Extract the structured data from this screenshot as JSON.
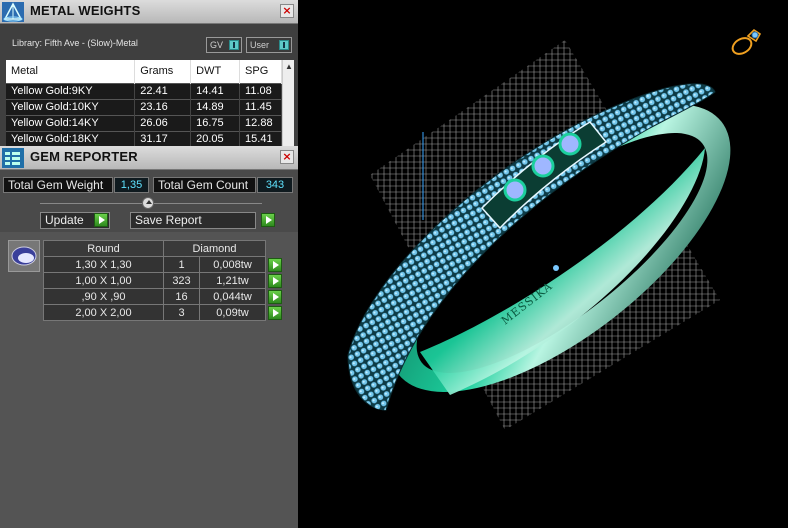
{
  "metal_weights": {
    "title": "METAL WEIGHTS",
    "close": "×",
    "library": "Library: Fifth Ave - (Slow)-Metal",
    "gv_label": "GV",
    "user_label": "User",
    "columns": [
      "Metal",
      "Grams",
      "DWT",
      "SPG"
    ],
    "rows": [
      [
        "Yellow Gold:9KY",
        "22.41",
        "14.41",
        "11.08"
      ],
      [
        "Yellow Gold:10KY",
        "23.16",
        "14.89",
        "11.45"
      ],
      [
        "Yellow Gold:14KY",
        "26.06",
        "16.75",
        "12.88"
      ],
      [
        "Yellow Gold:18KY",
        "31.17",
        "20.05",
        "15.41"
      ]
    ]
  },
  "gem_reporter": {
    "title": "GEM REPORTER",
    "close": "×",
    "total_weight_label": "Total Gem Weight",
    "total_weight_value": "1,35",
    "total_count_label": "Total Gem Count",
    "total_count_value": "343",
    "update_label": "Update",
    "save_label": "Save Report",
    "columns": [
      "Round",
      "Diamond"
    ],
    "rows": [
      [
        "1,30 X 1,30",
        "1",
        "0,008tw"
      ],
      [
        "1,00 X 1,00",
        "323",
        "1,21tw"
      ],
      [
        ",90 X ,90",
        "16",
        "0,044tw"
      ],
      [
        "2,00 X 2,00",
        "3",
        "0,09tw"
      ]
    ]
  },
  "viewport": {
    "engraving": "MESSIKA",
    "colors": {
      "band": "#15b58a",
      "gems": "#6ec3e8",
      "grid": "#cfcfcf",
      "background": "#000000"
    }
  }
}
